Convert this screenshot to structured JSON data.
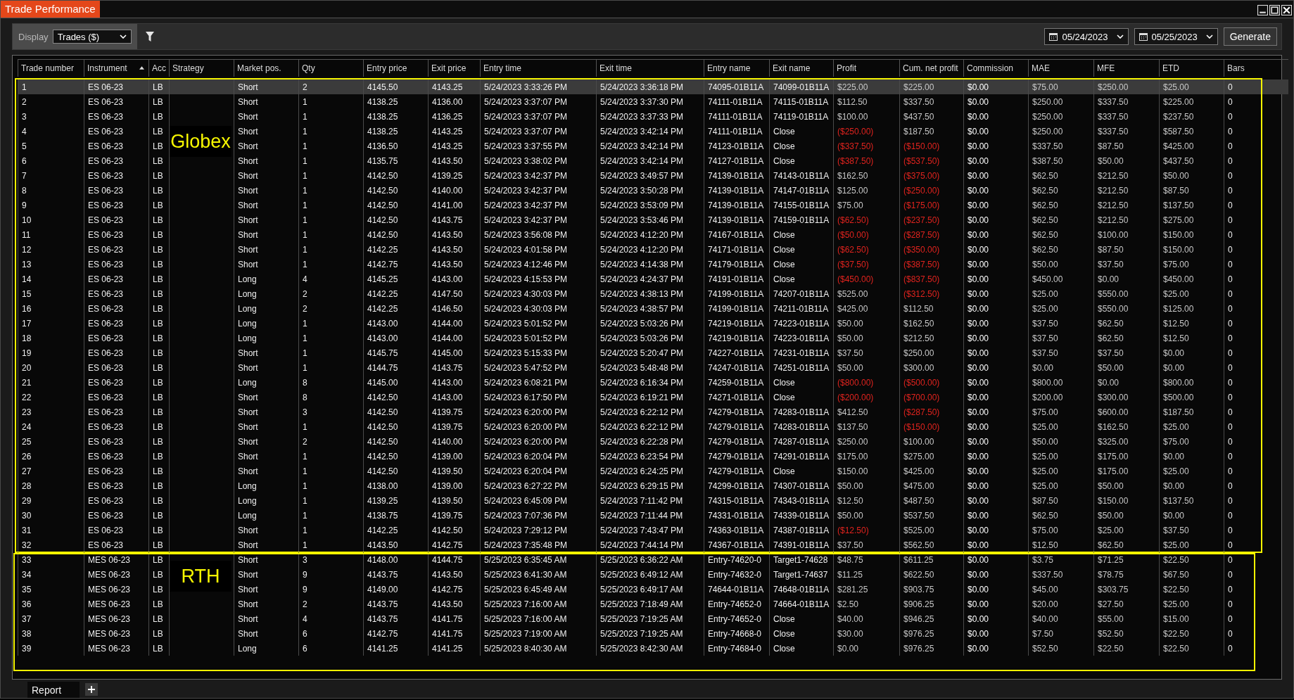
{
  "window": {
    "title": "Trade Performance"
  },
  "toolbar": {
    "display_label": "Display",
    "display_value": "Trades ($)",
    "from_date": "05/24/2023",
    "to_date": "05/25/2023",
    "generate": "Generate"
  },
  "table": {
    "columns": [
      {
        "label": "Trade number",
        "sorted": false
      },
      {
        "label": "Instrument",
        "sorted": true
      },
      {
        "label": "Acc",
        "sorted": false
      },
      {
        "label": "Strategy",
        "sorted": false
      },
      {
        "label": "Market pos.",
        "sorted": false
      },
      {
        "label": "Qty",
        "sorted": false
      },
      {
        "label": "Entry price",
        "sorted": false
      },
      {
        "label": "Exit price",
        "sorted": false
      },
      {
        "label": "Entry time",
        "sorted": false
      },
      {
        "label": "Exit time",
        "sorted": false
      },
      {
        "label": "Entry name",
        "sorted": false
      },
      {
        "label": "Exit name",
        "sorted": false
      },
      {
        "label": "Profit",
        "sorted": false
      },
      {
        "label": "Cum. net profit",
        "sorted": false
      },
      {
        "label": "Commission",
        "sorted": false
      },
      {
        "label": "MAE",
        "sorted": false
      },
      {
        "label": "MFE",
        "sorted": false
      },
      {
        "label": "ETD",
        "sorted": false
      },
      {
        "label": "Bars",
        "sorted": false
      }
    ],
    "sections": [
      {
        "label": "Globex",
        "rows": [
          {
            "selected": true,
            "profit_loss": false,
            "cum_loss": false,
            "values": [
              "1",
              "ES 06-23",
              "LB",
              "Short",
              "2",
              "4145.50",
              "4143.25",
              "5/24/2023 3:33:26 PM",
              "5/24/2023 3:36:18 PM",
              "74095-01B11A",
              "74099-01B11A",
              "$225.00",
              "$225.00",
              "$0.00",
              "$75.00",
              "$250.00",
              "$25.00",
              "0"
            ]
          },
          {
            "selected": false,
            "profit_loss": false,
            "cum_loss": false,
            "values": [
              "2",
              "ES 06-23",
              "LB",
              "Short",
              "1",
              "4138.25",
              "4136.00",
              "5/24/2023 3:37:07 PM",
              "5/24/2023 3:37:30 PM",
              "74111-01B11A",
              "74115-01B11A",
              "$112.50",
              "$337.50",
              "$0.00",
              "$250.00",
              "$337.50",
              "$225.00",
              "0"
            ]
          },
          {
            "selected": false,
            "profit_loss": false,
            "cum_loss": false,
            "values": [
              "3",
              "ES 06-23",
              "LB",
              "Short",
              "1",
              "4138.25",
              "4136.25",
              "5/24/2023 3:37:07 PM",
              "5/24/2023 3:37:33 PM",
              "74111-01B11A",
              "74119-01B11A",
              "$100.00",
              "$437.50",
              "$0.00",
              "$250.00",
              "$337.50",
              "$237.50",
              "0"
            ]
          },
          {
            "selected": false,
            "profit_loss": true,
            "cum_loss": false,
            "values": [
              "4",
              "ES 06-23",
              "LB",
              "Short",
              "1",
              "4138.25",
              "4143.25",
              "5/24/2023 3:37:07 PM",
              "5/24/2023 3:42:14 PM",
              "74111-01B11A",
              "Close",
              "($250.00)",
              "$187.50",
              "$0.00",
              "$250.00",
              "$337.50",
              "$587.50",
              "0"
            ]
          },
          {
            "selected": false,
            "profit_loss": true,
            "cum_loss": true,
            "values": [
              "5",
              "ES 06-23",
              "LB",
              "Short",
              "1",
              "4136.50",
              "4143.25",
              "5/24/2023 3:37:55 PM",
              "5/24/2023 3:42:14 PM",
              "74123-01B11A",
              "Close",
              "($337.50)",
              "($150.00)",
              "$0.00",
              "$337.50",
              "$87.50",
              "$425.00",
              "0"
            ]
          },
          {
            "selected": false,
            "profit_loss": true,
            "cum_loss": true,
            "values": [
              "6",
              "ES 06-23",
              "LB",
              "Short",
              "1",
              "4135.75",
              "4143.50",
              "5/24/2023 3:38:02 PM",
              "5/24/2023 3:42:14 PM",
              "74127-01B11A",
              "Close",
              "($387.50)",
              "($537.50)",
              "$0.00",
              "$387.50",
              "$50.00",
              "$437.50",
              "0"
            ]
          },
          {
            "selected": false,
            "profit_loss": false,
            "cum_loss": true,
            "values": [
              "7",
              "ES 06-23",
              "LB",
              "Short",
              "1",
              "4142.50",
              "4139.25",
              "5/24/2023 3:42:37 PM",
              "5/24/2023 3:49:57 PM",
              "74139-01B11A",
              "74143-01B11A",
              "$162.50",
              "($375.00)",
              "$0.00",
              "$62.50",
              "$212.50",
              "$50.00",
              "0"
            ]
          },
          {
            "selected": false,
            "profit_loss": false,
            "cum_loss": true,
            "values": [
              "8",
              "ES 06-23",
              "LB",
              "Short",
              "1",
              "4142.50",
              "4140.00",
              "5/24/2023 3:42:37 PM",
              "5/24/2023 3:50:28 PM",
              "74139-01B11A",
              "74147-01B11A",
              "$125.00",
              "($250.00)",
              "$0.00",
              "$62.50",
              "$212.50",
              "$87.50",
              "0"
            ]
          },
          {
            "selected": false,
            "profit_loss": false,
            "cum_loss": true,
            "values": [
              "9",
              "ES 06-23",
              "LB",
              "Short",
              "1",
              "4142.50",
              "4141.00",
              "5/24/2023 3:42:37 PM",
              "5/24/2023 3:53:09 PM",
              "74139-01B11A",
              "74155-01B11A",
              "$75.00",
              "($175.00)",
              "$0.00",
              "$62.50",
              "$212.50",
              "$137.50",
              "0"
            ]
          },
          {
            "selected": false,
            "profit_loss": true,
            "cum_loss": true,
            "values": [
              "10",
              "ES 06-23",
              "LB",
              "Short",
              "1",
              "4142.50",
              "4143.75",
              "5/24/2023 3:42:37 PM",
              "5/24/2023 3:53:46 PM",
              "74139-01B11A",
              "74159-01B11A",
              "($62.50)",
              "($237.50)",
              "$0.00",
              "$62.50",
              "$212.50",
              "$275.00",
              "0"
            ]
          },
          {
            "selected": false,
            "profit_loss": true,
            "cum_loss": true,
            "values": [
              "11",
              "ES 06-23",
              "LB",
              "Short",
              "1",
              "4142.50",
              "4143.50",
              "5/24/2023 3:56:08 PM",
              "5/24/2023 4:12:20 PM",
              "74167-01B11A",
              "Close",
              "($50.00)",
              "($287.50)",
              "$0.00",
              "$62.50",
              "$100.00",
              "$150.00",
              "0"
            ]
          },
          {
            "selected": false,
            "profit_loss": true,
            "cum_loss": true,
            "values": [
              "12",
              "ES 06-23",
              "LB",
              "Short",
              "1",
              "4142.25",
              "4143.50",
              "5/24/2023 4:01:58 PM",
              "5/24/2023 4:12:20 PM",
              "74171-01B11A",
              "Close",
              "($62.50)",
              "($350.00)",
              "$0.00",
              "$62.50",
              "$87.50",
              "$150.00",
              "0"
            ]
          },
          {
            "selected": false,
            "profit_loss": true,
            "cum_loss": true,
            "values": [
              "13",
              "ES 06-23",
              "LB",
              "Short",
              "1",
              "4142.75",
              "4143.50",
              "5/24/2023 4:12:46 PM",
              "5/24/2023 4:14:38 PM",
              "74179-01B11A",
              "Close",
              "($37.50)",
              "($387.50)",
              "$0.00",
              "$50.00",
              "$37.50",
              "$75.00",
              "0"
            ]
          },
          {
            "selected": false,
            "profit_loss": true,
            "cum_loss": true,
            "values": [
              "14",
              "ES 06-23",
              "LB",
              "Long",
              "4",
              "4145.25",
              "4143.00",
              "5/24/2023 4:15:53 PM",
              "5/24/2023 4:24:37 PM",
              "74191-01B11A",
              "Close",
              "($450.00)",
              "($837.50)",
              "$0.00",
              "$450.00",
              "$0.00",
              "$450.00",
              "0"
            ]
          },
          {
            "selected": false,
            "profit_loss": false,
            "cum_loss": true,
            "values": [
              "15",
              "ES 06-23",
              "LB",
              "Long",
              "2",
              "4142.25",
              "4147.50",
              "5/24/2023 4:30:03 PM",
              "5/24/2023 4:38:13 PM",
              "74199-01B11A",
              "74207-01B11A",
              "$525.00",
              "($312.50)",
              "$0.00",
              "$25.00",
              "$550.00",
              "$25.00",
              "0"
            ]
          },
          {
            "selected": false,
            "profit_loss": false,
            "cum_loss": false,
            "values": [
              "16",
              "ES 06-23",
              "LB",
              "Long",
              "2",
              "4142.25",
              "4146.50",
              "5/24/2023 4:30:03 PM",
              "5/24/2023 4:38:57 PM",
              "74199-01B11A",
              "74211-01B11A",
              "$425.00",
              "$112.50",
              "$0.00",
              "$25.00",
              "$550.00",
              "$125.00",
              "0"
            ]
          },
          {
            "selected": false,
            "profit_loss": false,
            "cum_loss": false,
            "values": [
              "17",
              "ES 06-23",
              "LB",
              "Long",
              "1",
              "4143.00",
              "4144.00",
              "5/24/2023 5:01:52 PM",
              "5/24/2023 5:03:26 PM",
              "74219-01B11A",
              "74223-01B11A",
              "$50.00",
              "$162.50",
              "$0.00",
              "$37.50",
              "$62.50",
              "$12.50",
              "0"
            ]
          },
          {
            "selected": false,
            "profit_loss": false,
            "cum_loss": false,
            "values": [
              "18",
              "ES 06-23",
              "LB",
              "Long",
              "1",
              "4143.00",
              "4144.00",
              "5/24/2023 5:01:52 PM",
              "5/24/2023 5:03:26 PM",
              "74219-01B11A",
              "74223-01B11A",
              "$50.00",
              "$212.50",
              "$0.00",
              "$37.50",
              "$62.50",
              "$12.50",
              "0"
            ]
          },
          {
            "selected": false,
            "profit_loss": false,
            "cum_loss": false,
            "values": [
              "19",
              "ES 06-23",
              "LB",
              "Short",
              "1",
              "4145.75",
              "4145.00",
              "5/24/2023 5:15:33 PM",
              "5/24/2023 5:20:47 PM",
              "74227-01B11A",
              "74231-01B11A",
              "$37.50",
              "$250.00",
              "$0.00",
              "$37.50",
              "$37.50",
              "$0.00",
              "0"
            ]
          },
          {
            "selected": false,
            "profit_loss": false,
            "cum_loss": false,
            "values": [
              "20",
              "ES 06-23",
              "LB",
              "Short",
              "1",
              "4144.75",
              "4143.75",
              "5/24/2023 5:47:52 PM",
              "5/24/2023 5:48:48 PM",
              "74247-01B11A",
              "74251-01B11A",
              "$50.00",
              "$300.00",
              "$0.00",
              "$0.00",
              "$50.00",
              "$0.00",
              "0"
            ]
          },
          {
            "selected": false,
            "profit_loss": true,
            "cum_loss": true,
            "values": [
              "21",
              "ES 06-23",
              "LB",
              "Long",
              "8",
              "4145.00",
              "4143.00",
              "5/24/2023 6:08:21 PM",
              "5/24/2023 6:16:34 PM",
              "74259-01B11A",
              "Close",
              "($800.00)",
              "($500.00)",
              "$0.00",
              "$800.00",
              "$0.00",
              "$800.00",
              "0"
            ]
          },
          {
            "selected": false,
            "profit_loss": true,
            "cum_loss": true,
            "values": [
              "22",
              "ES 06-23",
              "LB",
              "Short",
              "8",
              "4142.50",
              "4143.00",
              "5/24/2023 6:17:50 PM",
              "5/24/2023 6:19:21 PM",
              "74271-01B11A",
              "Close",
              "($200.00)",
              "($700.00)",
              "$0.00",
              "$200.00",
              "$300.00",
              "$500.00",
              "0"
            ]
          },
          {
            "selected": false,
            "profit_loss": false,
            "cum_loss": true,
            "values": [
              "23",
              "ES 06-23",
              "LB",
              "Short",
              "3",
              "4142.50",
              "4139.75",
              "5/24/2023 6:20:00 PM",
              "5/24/2023 6:22:12 PM",
              "74279-01B11A",
              "74283-01B11A",
              "$412.50",
              "($287.50)",
              "$0.00",
              "$75.00",
              "$600.00",
              "$187.50",
              "0"
            ]
          },
          {
            "selected": false,
            "profit_loss": false,
            "cum_loss": true,
            "values": [
              "24",
              "ES 06-23",
              "LB",
              "Short",
              "1",
              "4142.50",
              "4139.75",
              "5/24/2023 6:20:00 PM",
              "5/24/2023 6:22:12 PM",
              "74279-01B11A",
              "74283-01B11A",
              "$137.50",
              "($150.00)",
              "$0.00",
              "$25.00",
              "$162.50",
              "$25.00",
              "0"
            ]
          },
          {
            "selected": false,
            "profit_loss": false,
            "cum_loss": false,
            "values": [
              "25",
              "ES 06-23",
              "LB",
              "Short",
              "2",
              "4142.50",
              "4140.00",
              "5/24/2023 6:20:00 PM",
              "5/24/2023 6:22:28 PM",
              "74279-01B11A",
              "74287-01B11A",
              "$250.00",
              "$100.00",
              "$0.00",
              "$50.00",
              "$325.00",
              "$75.00",
              "0"
            ]
          },
          {
            "selected": false,
            "profit_loss": false,
            "cum_loss": false,
            "values": [
              "26",
              "ES 06-23",
              "LB",
              "Short",
              "1",
              "4142.50",
              "4139.00",
              "5/24/2023 6:20:04 PM",
              "5/24/2023 6:23:54 PM",
              "74279-01B11A",
              "74291-01B11A",
              "$175.00",
              "$275.00",
              "$0.00",
              "$25.00",
              "$175.00",
              "$0.00",
              "0"
            ]
          },
          {
            "selected": false,
            "profit_loss": false,
            "cum_loss": false,
            "values": [
              "27",
              "ES 06-23",
              "LB",
              "Short",
              "1",
              "4142.50",
              "4139.50",
              "5/24/2023 6:20:04 PM",
              "5/24/2023 6:24:25 PM",
              "74279-01B11A",
              "Close",
              "$150.00",
              "$425.00",
              "$0.00",
              "$25.00",
              "$175.00",
              "$25.00",
              "0"
            ]
          },
          {
            "selected": false,
            "profit_loss": false,
            "cum_loss": false,
            "values": [
              "28",
              "ES 06-23",
              "LB",
              "Long",
              "1",
              "4138.00",
              "4139.00",
              "5/24/2023 6:27:22 PM",
              "5/24/2023 6:29:15 PM",
              "74299-01B11A",
              "74307-01B11A",
              "$50.00",
              "$475.00",
              "$0.00",
              "$25.00",
              "$50.00",
              "$0.00",
              "0"
            ]
          },
          {
            "selected": false,
            "profit_loss": false,
            "cum_loss": false,
            "values": [
              "29",
              "ES 06-23",
              "LB",
              "Long",
              "1",
              "4139.25",
              "4139.50",
              "5/24/2023 6:45:09 PM",
              "5/24/2023 7:11:42 PM",
              "74315-01B11A",
              "74343-01B11A",
              "$12.50",
              "$487.50",
              "$0.00",
              "$87.50",
              "$150.00",
              "$137.50",
              "0"
            ]
          },
          {
            "selected": false,
            "profit_loss": false,
            "cum_loss": false,
            "values": [
              "30",
              "ES 06-23",
              "LB",
              "Long",
              "1",
              "4138.75",
              "4139.75",
              "5/24/2023 7:07:36 PM",
              "5/24/2023 7:11:44 PM",
              "74331-01B11A",
              "74339-01B11A",
              "$50.00",
              "$537.50",
              "$0.00",
              "$62.50",
              "$50.00",
              "$0.00",
              "0"
            ]
          },
          {
            "selected": false,
            "profit_loss": true,
            "cum_loss": false,
            "values": [
              "31",
              "ES 06-23",
              "LB",
              "Short",
              "1",
              "4142.25",
              "4142.50",
              "5/24/2023 7:29:12 PM",
              "5/24/2023 7:43:47 PM",
              "74363-01B11A",
              "74387-01B11A",
              "($12.50)",
              "$525.00",
              "$0.00",
              "$75.00",
              "$25.00",
              "$37.50",
              "0"
            ]
          },
          {
            "selected": false,
            "profit_loss": false,
            "cum_loss": false,
            "values": [
              "32",
              "ES 06-23",
              "LB",
              "Short",
              "1",
              "4143.50",
              "4142.75",
              "5/24/2023 7:35:48 PM",
              "5/24/2023 7:44:14 PM",
              "74367-01B11A",
              "74391-01B11A",
              "$37.50",
              "$562.50",
              "$0.00",
              "$12.50",
              "$62.50",
              "$25.00",
              "0"
            ]
          }
        ]
      },
      {
        "label": "RTH",
        "rows": [
          {
            "selected": false,
            "profit_loss": false,
            "cum_loss": false,
            "values": [
              "33",
              "MES 06-23",
              "LB",
              "Short",
              "3",
              "4148.00",
              "4144.75",
              "5/25/2023 6:35:45 AM",
              "5/25/2023 6:36:22 AM",
              "Entry-74620-0",
              "Target1-74628",
              "$48.75",
              "$611.25",
              "$0.00",
              "$3.75",
              "$71.25",
              "$22.50",
              "0"
            ]
          },
          {
            "selected": false,
            "profit_loss": false,
            "cum_loss": false,
            "values": [
              "34",
              "MES 06-23",
              "LB",
              "Short",
              "9",
              "4143.75",
              "4143.50",
              "5/25/2023 6:41:30 AM",
              "5/25/2023 6:49:12 AM",
              "Entry-74632-0",
              "Target1-74637",
              "$11.25",
              "$622.50",
              "$0.00",
              "$337.50",
              "$78.75",
              "$67.50",
              "0"
            ]
          },
          {
            "selected": false,
            "profit_loss": false,
            "cum_loss": false,
            "values": [
              "35",
              "MES 06-23",
              "LB",
              "Short",
              "9",
              "4149.00",
              "4142.75",
              "5/25/2023 6:45:49 AM",
              "5/25/2023 6:49:17 AM",
              "74644-01B11A",
              "74648-01B11A",
              "$281.25",
              "$903.75",
              "$0.00",
              "$45.00",
              "$303.75",
              "$22.50",
              "0"
            ]
          },
          {
            "selected": false,
            "profit_loss": false,
            "cum_loss": false,
            "values": [
              "36",
              "MES 06-23",
              "LB",
              "Short",
              "2",
              "4143.75",
              "4143.50",
              "5/25/2023 7:16:00 AM",
              "5/25/2023 7:18:49 AM",
              "Entry-74652-0",
              "74664-01B11A",
              "$2.50",
              "$906.25",
              "$0.00",
              "$20.00",
              "$27.50",
              "$25.00",
              "0"
            ]
          },
          {
            "selected": false,
            "profit_loss": false,
            "cum_loss": false,
            "values": [
              "37",
              "MES 06-23",
              "LB",
              "Short",
              "4",
              "4143.75",
              "4141.75",
              "5/25/2023 7:16:00 AM",
              "5/25/2023 7:19:25 AM",
              "Entry-74652-0",
              "Close",
              "$40.00",
              "$946.25",
              "$0.00",
              "$40.00",
              "$55.00",
              "$15.00",
              "0"
            ]
          },
          {
            "selected": false,
            "profit_loss": false,
            "cum_loss": false,
            "values": [
              "38",
              "MES 06-23",
              "LB",
              "Short",
              "6",
              "4142.75",
              "4141.75",
              "5/25/2023 7:19:00 AM",
              "5/25/2023 7:19:25 AM",
              "Entry-74668-0",
              "Close",
              "$30.00",
              "$976.25",
              "$0.00",
              "$7.50",
              "$52.50",
              "$22.50",
              "0"
            ]
          },
          {
            "selected": false,
            "profit_loss": false,
            "cum_loss": false,
            "values": [
              "39",
              "MES 06-23",
              "LB",
              "Long",
              "6",
              "4141.25",
              "4141.25",
              "5/25/2023 8:40:30 AM",
              "5/25/2023 8:42:30 AM",
              "Entry-74684-0",
              "Close",
              "$0.00",
              "$976.25",
              "$0.00",
              "$52.50",
              "$22.50",
              "$22.50",
              "0"
            ]
          }
        ]
      }
    ]
  },
  "bottom_tabs": [
    {
      "label": "Report",
      "selected": true
    }
  ]
}
